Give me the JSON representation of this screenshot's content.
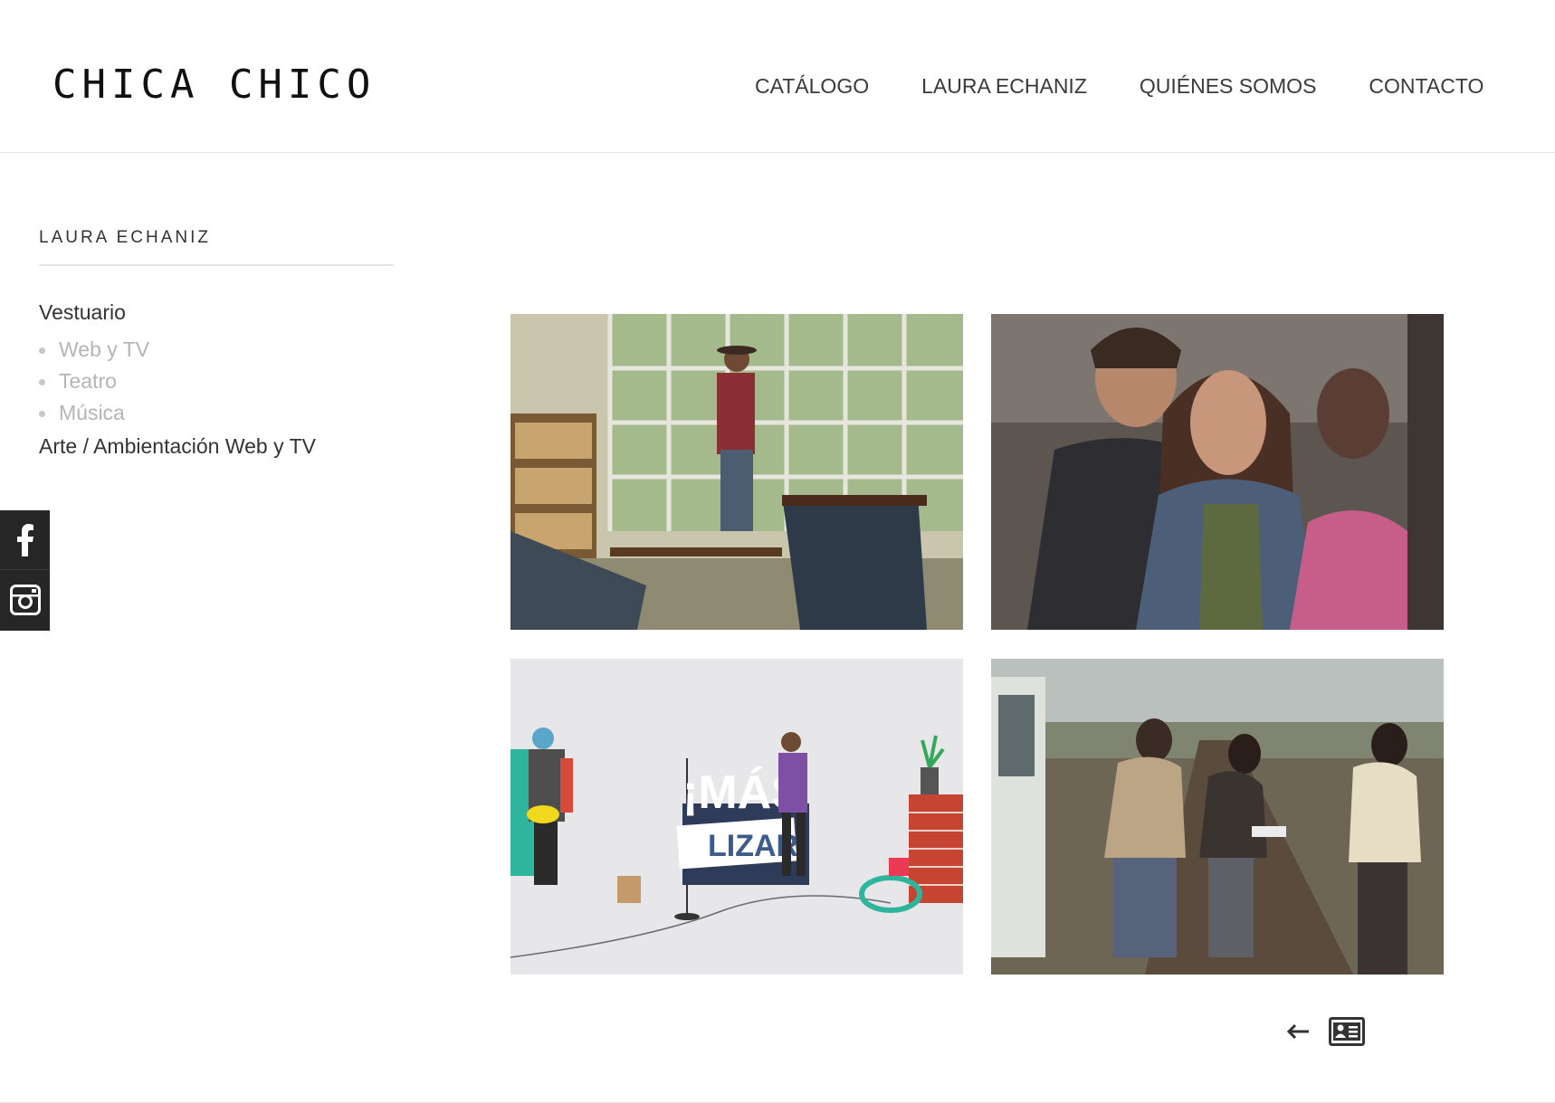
{
  "header": {
    "logo": "CHICA CHICO",
    "nav": [
      "CATÁLOGO",
      "LAURA ECHANIZ",
      "QUIÉNES SOMOS",
      "CONTACTO"
    ]
  },
  "sidebar": {
    "title": "LAURA ECHANIZ",
    "category1": "Vestuario",
    "subitems": [
      "Web y TV",
      "Teatro",
      "Música"
    ],
    "category2": "Arte / Ambientación Web y TV"
  },
  "social": {
    "icons": [
      "facebook-icon",
      "instagram-icon"
    ],
    "background": "#262626"
  },
  "gallery": {
    "items": [
      "photo-1",
      "photo-2",
      "photo-3",
      "photo-4"
    ],
    "overlay_text_1": "¡MÁS",
    "overlay_text_2": "LIZAR"
  },
  "pager": {
    "back_icon": "arrow-left-icon",
    "card_icon": "contact-card-icon"
  }
}
